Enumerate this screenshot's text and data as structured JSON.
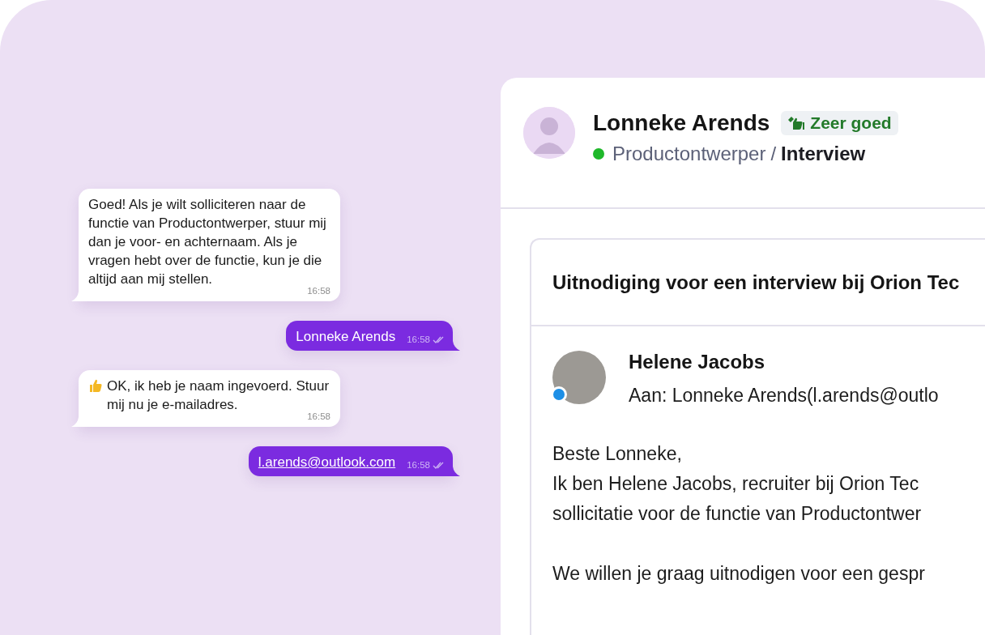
{
  "chat": {
    "messages": [
      {
        "kind": "incoming",
        "text": "Goed! Als je wilt solliciteren naar de functie van Productontwerper, stuur mij dan je voor- en achternaam. Als je vragen hebt over de functie, kun je die altijd aan mij stellen.",
        "time": "16:58",
        "thumbs": false,
        "link": false
      },
      {
        "kind": "outgoing",
        "text": "Lonneke Arends",
        "time": "16:58",
        "thumbs": false,
        "link": false
      },
      {
        "kind": "incoming",
        "text": "OK, ik heb je naam ingevoerd. Stuur mij nu je e-mailadres.",
        "time": "16:58",
        "thumbs": true,
        "link": false
      },
      {
        "kind": "outgoing",
        "text": "l.arends@outlook.com",
        "time": "16:58",
        "thumbs": false,
        "link": true
      }
    ]
  },
  "candidate": {
    "name": "Lonneke Arends",
    "rating": "Zeer goed",
    "role": "Productontwerper",
    "separator": "/",
    "stage": "Interview"
  },
  "email": {
    "subject": "Uitnodiging voor een interview bij Orion Tec",
    "sender": "Helene Jacobs",
    "online": true,
    "to": "Aan: Lonneke Arends(l.arends@outlo",
    "paragraphs": [
      [
        "Beste Lonneke,",
        "Ik ben Helene Jacobs, recruiter bij Orion Tec",
        "sollicitatie voor de functie van Productontwer"
      ],
      [
        "We willen je graag uitnodigen voor een gespr"
      ]
    ]
  }
}
